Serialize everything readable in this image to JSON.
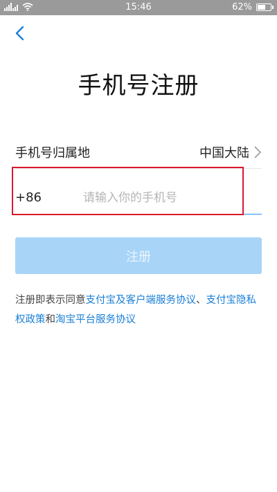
{
  "status_bar": {
    "time": "15:46",
    "battery_percent_label": "62%",
    "battery_level": 0.62,
    "signal_icon": "signal-icon",
    "wifi_icon": "wifi-icon"
  },
  "header": {
    "back_icon": "back-chevron-icon",
    "title": "手机号注册"
  },
  "form": {
    "region_label": "手机号归属地",
    "region_value": "中国大陆",
    "country_code": "+86",
    "phone_placeholder": "请输入你的手机号",
    "phone_value": ""
  },
  "actions": {
    "register_label": "注册"
  },
  "agreement": {
    "prefix": "注册即表示同意",
    "link_1": "支付宝及客户端服务协议",
    "separator": "、",
    "link_2": "支付宝隐私权政策",
    "conjunction": "和",
    "link_3": "淘宝平台服务协议"
  },
  "colors": {
    "accent": "#1a7fd6",
    "button_disabled": "#a8d5f7",
    "highlight_box": "#d9182d",
    "input_underline": "#1e90ff"
  }
}
